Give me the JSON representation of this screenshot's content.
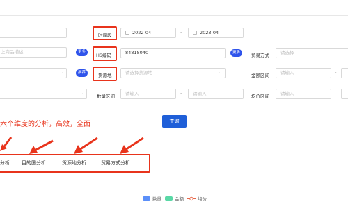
{
  "filters": {
    "partial_input_placeholder": "上商品描述",
    "more_label": "更多",
    "recommend_label": "推荐",
    "time_period": {
      "label": "时间段",
      "start": "2022-04",
      "end": "2023-04",
      "separator": "-"
    },
    "hs_code": {
      "label": "HS编码",
      "value": "84818040",
      "more_label": "更多"
    },
    "trade_mode": {
      "label": "贸易方式",
      "placeholder": "请选择"
    },
    "origin": {
      "label": "货源地",
      "placeholder": "请选择货源地"
    },
    "amount_range": {
      "label": "金额区间",
      "placeholder": "请输入",
      "separator": "-"
    },
    "quantity_range": {
      "label": "数量区间",
      "placeholder_min": "请输入",
      "placeholder_max": "请输入",
      "separator": "-"
    },
    "avg_price_range": {
      "label": "均价区间",
      "placeholder": "请输入"
    }
  },
  "query_button": "查询",
  "annotation_text": "六个维度的分析，高效，全面",
  "tabs": [
    {
      "label": "分析"
    },
    {
      "label": "目的国分析"
    },
    {
      "label": "货源地分析"
    },
    {
      "label": "贸易方式分析"
    }
  ],
  "legend": {
    "items": [
      {
        "label": "数量",
        "color": "#5b8ff9"
      },
      {
        "label": "金额",
        "color": "#5ad8a6"
      },
      {
        "label": "均价",
        "color": "#e8684a"
      }
    ]
  },
  "colors": {
    "accent": "#1f5fd8",
    "annotation": "#e8341c"
  }
}
